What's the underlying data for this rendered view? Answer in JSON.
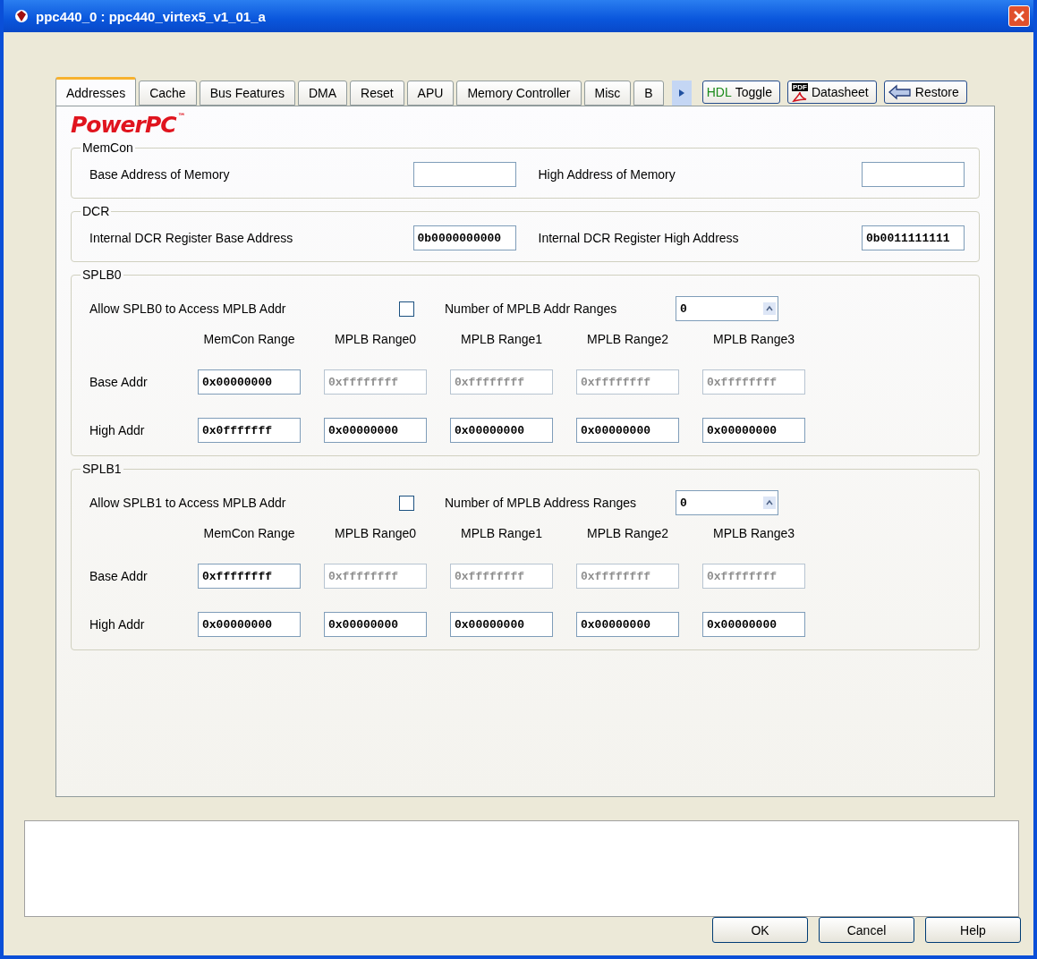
{
  "window": {
    "title": "ppc440_0 : ppc440_virtex5_v1_01_a"
  },
  "tabs": [
    {
      "label": "Addresses",
      "selected": true
    },
    {
      "label": "Cache",
      "selected": false
    },
    {
      "label": "Bus Features",
      "selected": false
    },
    {
      "label": "DMA",
      "selected": false
    },
    {
      "label": "Reset",
      "selected": false
    },
    {
      "label": "APU",
      "selected": false
    },
    {
      "label": "Memory Controller",
      "selected": false
    },
    {
      "label": "Misc",
      "selected": false
    },
    {
      "label": "B",
      "selected": false
    }
  ],
  "toolbar_buttons": [
    {
      "kind": "hdl",
      "badge": "HDL",
      "label": "Toggle"
    },
    {
      "kind": "pdf",
      "badge": "PDF",
      "label": "Datasheet"
    },
    {
      "kind": "restore",
      "label": "Restore"
    }
  ],
  "logo": {
    "text": "PowerPC",
    "mark": "™"
  },
  "address_groups": [
    {
      "title": "MemCon",
      "fields": [
        {
          "label": "Base Address of Memory"
        },
        {
          "label": "High Address of Memory"
        }
      ]
    },
    {
      "title": "DCR",
      "fields": [
        {
          "label": "Internal DCR Register Base Address",
          "value": "0b0000000000"
        },
        {
          "label": "Internal DCR Register High Address",
          "value": "0b0011111111"
        }
      ]
    }
  ],
  "splb_groups": [
    {
      "title": "SPLB0",
      "allow_label": "Allow SPLB0 to Access MPLB Addr",
      "checked": false,
      "count_label": "Number of MPLB Addr Ranges",
      "count": "0",
      "columns": [
        "MemCon Range",
        "MPLB Range0",
        "MPLB Range1",
        "MPLB Range2",
        "MPLB Range3"
      ],
      "rows": [
        {
          "label": "Base Addr",
          "cells": [
            {
              "value": "0x00000000",
              "disabled": false
            },
            {
              "value": "0xffffffff",
              "disabled": true
            },
            {
              "value": "0xffffffff",
              "disabled": true
            },
            {
              "value": "0xffffffff",
              "disabled": true
            },
            {
              "value": "0xffffffff",
              "disabled": true
            }
          ]
        },
        {
          "label": "High Addr",
          "cells": [
            {
              "value": "0x0fffffff",
              "disabled": false
            },
            {
              "value": "0x00000000",
              "disabled": false
            },
            {
              "value": "0x00000000",
              "disabled": false
            },
            {
              "value": "0x00000000",
              "disabled": false
            },
            {
              "value": "0x00000000",
              "disabled": false
            }
          ]
        }
      ]
    },
    {
      "title": "SPLB1",
      "allow_label": "Allow SPLB1 to Access MPLB Addr",
      "checked": false,
      "count_label": "Number of MPLB Address Ranges",
      "count": "0",
      "columns": [
        "MemCon Range",
        "MPLB Range0",
        "MPLB Range1",
        "MPLB Range2",
        "MPLB Range3"
      ],
      "rows": [
        {
          "label": "Base Addr",
          "cells": [
            {
              "value": "0xffffffff",
              "disabled": false
            },
            {
              "value": "0xffffffff",
              "disabled": true
            },
            {
              "value": "0xffffffff",
              "disabled": true
            },
            {
              "value": "0xffffffff",
              "disabled": true
            },
            {
              "value": "0xffffffff",
              "disabled": true
            }
          ]
        },
        {
          "label": "High Addr",
          "cells": [
            {
              "value": "0x00000000",
              "disabled": false
            },
            {
              "value": "0x00000000",
              "disabled": false
            },
            {
              "value": "0x00000000",
              "disabled": false
            },
            {
              "value": "0x00000000",
              "disabled": false
            },
            {
              "value": "0x00000000",
              "disabled": false
            }
          ]
        }
      ]
    }
  ],
  "buttons": [
    "OK",
    "Cancel",
    "Help"
  ]
}
